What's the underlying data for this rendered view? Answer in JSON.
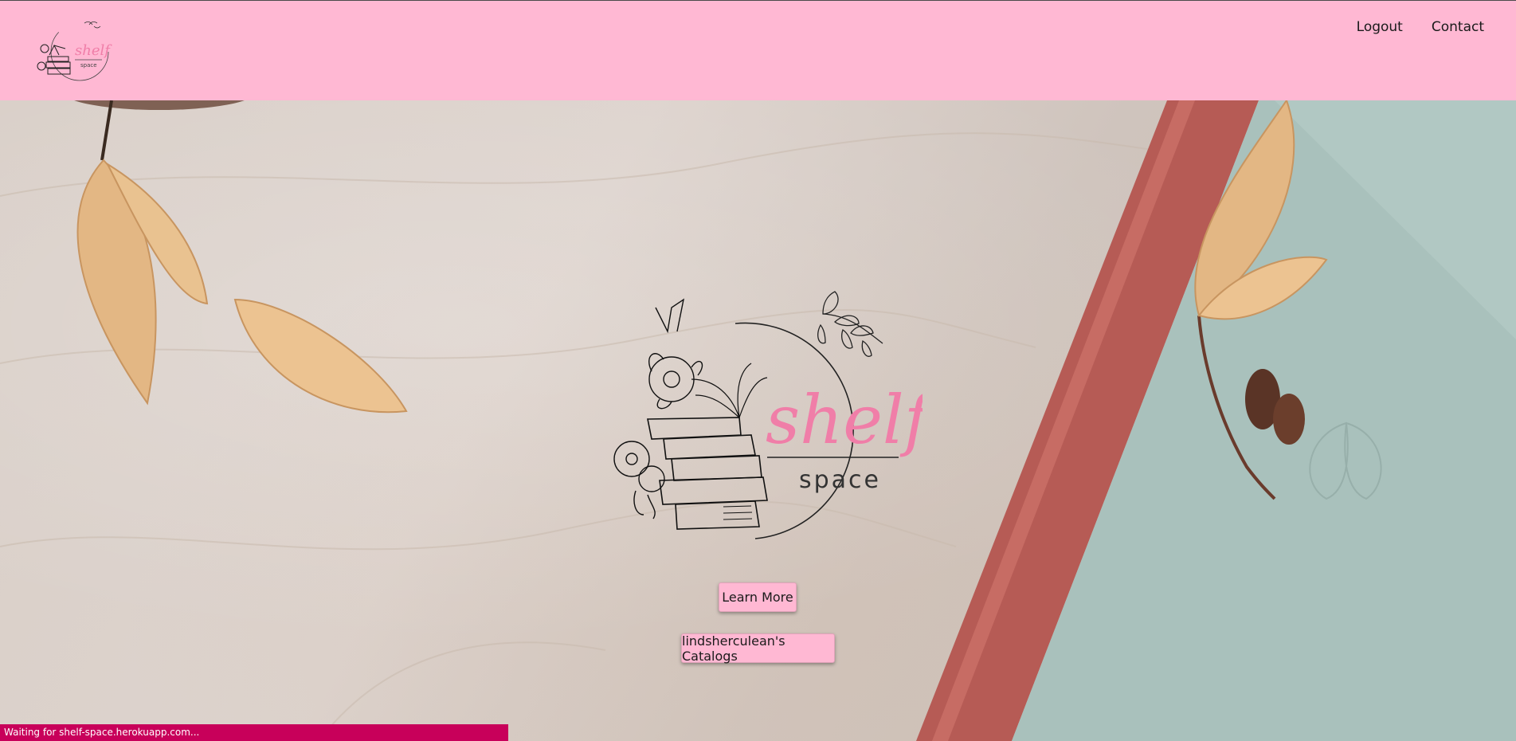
{
  "nav": {
    "logout_label": "Logout",
    "contact_label": "Contact",
    "logo_icon": "shelf-space-logo"
  },
  "hero": {
    "logo_word_main": "shelf",
    "logo_word_sub": "space",
    "learn_more_label": "Learn More",
    "catalogs_label": "lindsherculean's Catalogs"
  },
  "status": {
    "text": "Waiting for shelf-space.herokuapp.com..."
  },
  "colors": {
    "nav_bg": "#ffb8d3",
    "button_bg": "#ffb8d3",
    "status_bg": "#c8005a",
    "logo_pink": "#f07ea8"
  }
}
